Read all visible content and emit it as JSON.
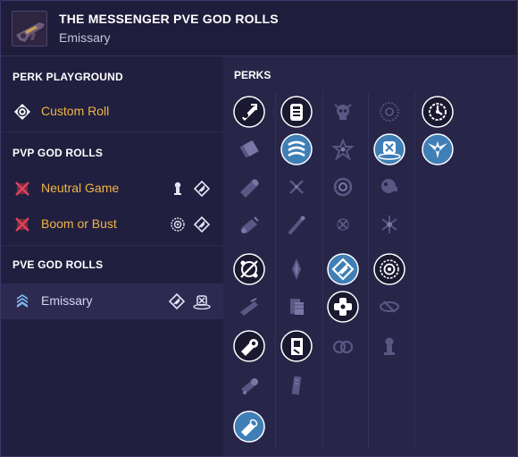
{
  "header": {
    "title": "THE MESSENGER PVE GOD ROLLS",
    "subtitle": "Emissary"
  },
  "left": {
    "perk_playground": {
      "title": "PERK PLAYGROUND",
      "items": [
        {
          "label": "Custom Roll",
          "icon": "target-reticle-icon"
        }
      ]
    },
    "pvp": {
      "title": "PVP GOD ROLLS",
      "items": [
        {
          "label": "Neutral Game",
          "icon": "crossed-out-icon",
          "mini_icons": [
            "grip-icon",
            "exotic-perk-icon"
          ]
        },
        {
          "label": "Boom or Bust",
          "icon": "crossed-out-icon",
          "mini_icons": [
            "rangefinder-icon",
            "exotic-perk-icon"
          ]
        }
      ]
    },
    "pve": {
      "title": "PVE GOD ROLLS",
      "items": [
        {
          "label": "Emissary",
          "icon": "chevron-rank-icon",
          "mini_icons": [
            "exotic-perk-icon",
            "target-lock-icon"
          ]
        }
      ]
    }
  },
  "perks": {
    "title": "PERKS"
  },
  "colors": {
    "accent_orange": "#f0b545",
    "selected_blue": "#3f7fb6",
    "panel_dark": "#211f3f",
    "panel_right": "#272548"
  }
}
